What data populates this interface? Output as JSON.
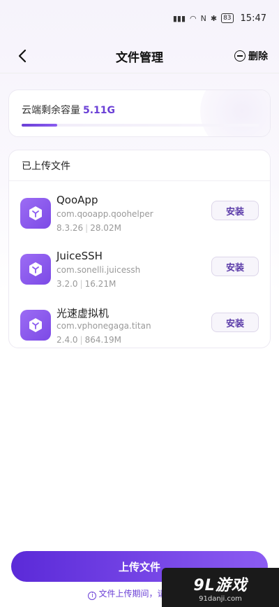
{
  "status_bar": {
    "icons": [
      "signal-icon",
      "5g-signal-icon",
      "5g-signal-icon",
      "wifi-icon",
      "nfc-icon",
      "bluetooth-icon",
      "vibrate-icon"
    ],
    "battery": "83",
    "time": "15:47"
  },
  "nav": {
    "title": "文件管理",
    "delete_label": "删除"
  },
  "storage": {
    "label": "云端剩余容量",
    "value": "5.11G",
    "used_fraction": 0.15
  },
  "files": {
    "header": "已上传文件",
    "items": [
      {
        "name": "QooApp",
        "package": "com.qooapp.qoohelper",
        "version": "8.3.26",
        "size": "28.02M",
        "action": "安装"
      },
      {
        "name": "JuiceSSH",
        "package": "com.sonelli.juicessh",
        "version": "3.2.0",
        "size": "16.21M",
        "action": "安装"
      },
      {
        "name": "光速虚拟机",
        "package": "com.vphonegaga.titan",
        "version": "2.4.0",
        "size": "864.19M",
        "action": "安装"
      }
    ]
  },
  "upload": {
    "button_label": "上传文件",
    "note": "文件上传期间，请不要退"
  },
  "watermark": {
    "brand": "9L游戏",
    "url": "91danji.com"
  },
  "colors": {
    "accent": "#6a3fd6",
    "icon_bg": "#8c5cf0"
  }
}
